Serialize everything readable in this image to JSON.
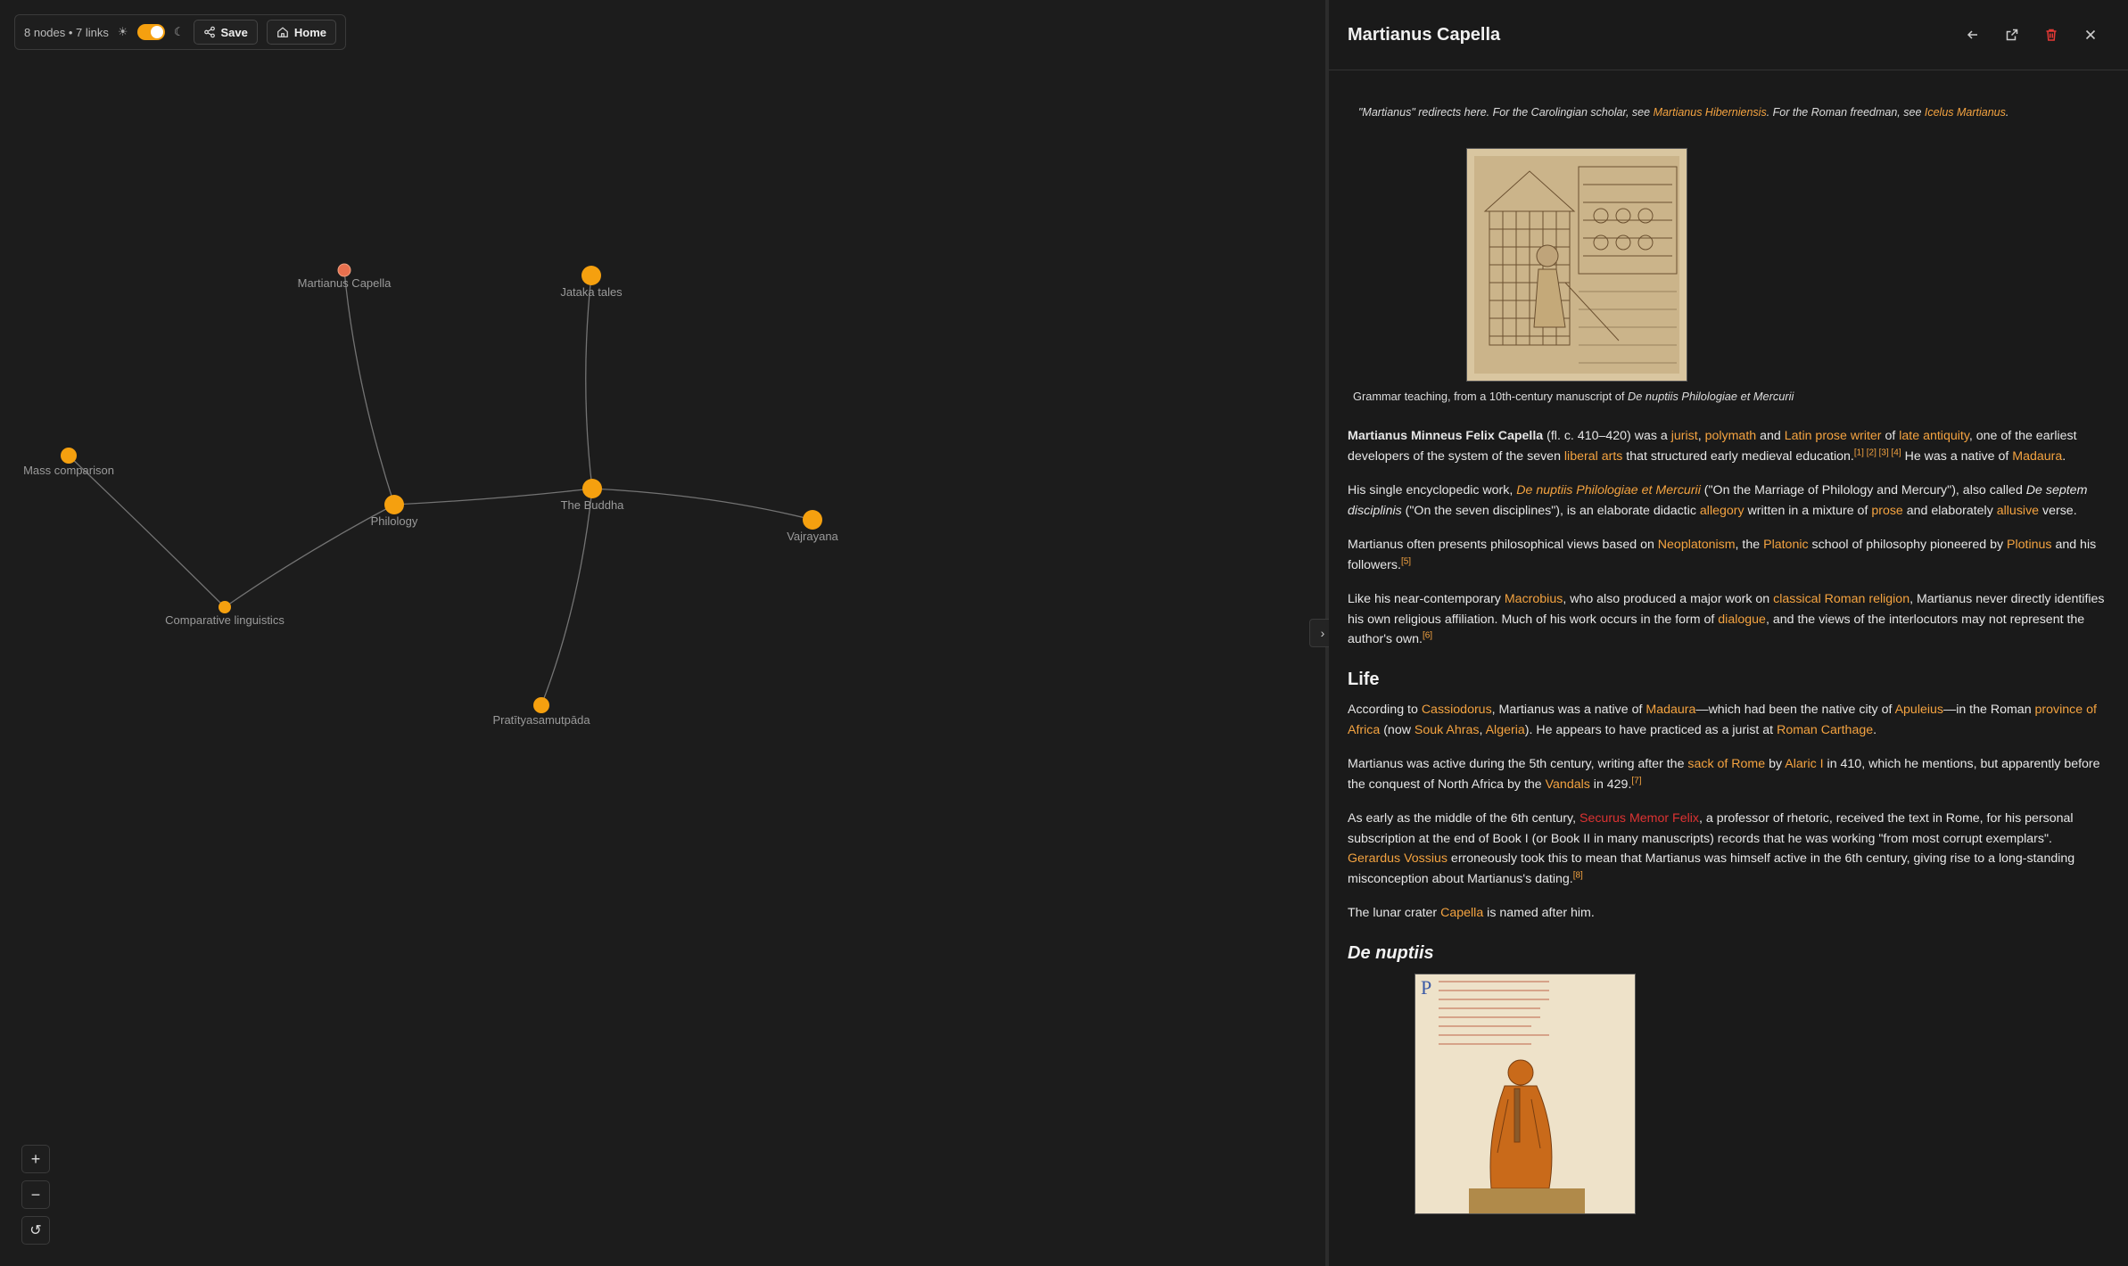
{
  "toolbar": {
    "stats": "8 nodes • 7 links",
    "save_label": "Save",
    "home_label": "Home",
    "theme_dark": true
  },
  "graph": {
    "nodes": [
      {
        "id": "martianus",
        "label": "Martianus Capella",
        "color": "#e8704e",
        "size": "small",
        "selected": true
      },
      {
        "id": "jataka",
        "label": "Jataka tales",
        "color": "#f5a00f",
        "size": "large"
      },
      {
        "id": "mass",
        "label": "Mass comparison",
        "color": "#f5a00f",
        "size": "medium"
      },
      {
        "id": "philology",
        "label": "Philology",
        "color": "#f5a00f",
        "size": "large"
      },
      {
        "id": "buddha",
        "label": "The Buddha",
        "color": "#f5a00f",
        "size": "large"
      },
      {
        "id": "vajrayana",
        "label": "Vajrayana",
        "color": "#f5a00f",
        "size": "large"
      },
      {
        "id": "complin",
        "label": "Comparative linguistics",
        "color": "#f5a00f",
        "size": "small"
      },
      {
        "id": "prat",
        "label": "Pratītyasamutpāda",
        "color": "#f5a00f",
        "size": "medium"
      }
    ],
    "links": [
      {
        "source": "martianus",
        "target": "philology"
      },
      {
        "source": "jataka",
        "target": "buddha"
      },
      {
        "source": "buddha",
        "target": "philology"
      },
      {
        "source": "buddha",
        "target": "vajrayana"
      },
      {
        "source": "buddha",
        "target": "prat"
      },
      {
        "source": "philology",
        "target": "complin"
      },
      {
        "source": "mass",
        "target": "complin"
      }
    ]
  },
  "zoom": {
    "in": "+",
    "out": "−",
    "reset": "↺"
  },
  "panel": {
    "title": "Martianus Capella",
    "hatnote": {
      "t1": "\"Martianus\" redirects here. For the Carolingian scholar, see ",
      "l1": "Martianus Hiberniensis",
      "t2": ". For the Roman freedman, see ",
      "l2": "Icelus Martianus",
      "t3": "."
    },
    "figure1_caption_pre": "Grammar teaching, from a 10th-century manuscript of ",
    "figure1_caption_it": "De nuptiis Philologiae et Mercurii",
    "p1": {
      "b": "Martianus Minneus Felix Capella",
      "t1": " (fl. c. 410–420) was a ",
      "l1": "jurist",
      "t2": ", ",
      "l2": "polymath",
      "t3": " and ",
      "l3": "Latin prose writer",
      "t4": " of ",
      "l4": "late antiquity",
      "t5": ", one of the earliest developers of the system of the seven ",
      "l5": "liberal arts",
      "t6": " that structured early medieval education.",
      "sup": "[1] [2] [3] [4]",
      "t7": " He was a native of ",
      "l6": "Madaura",
      "t8": "."
    },
    "p2": {
      "t1": "His single encyclopedic work, ",
      "l1": "De nuptiis Philologiae et Mercurii",
      "t2": " (\"On the Marriage of Philology and Mercury\"), also called ",
      "i1": "De septem disciplinis",
      "t3": " (\"On the seven disciplines\"), is an elaborate didactic ",
      "l2": "allegory",
      "t4": " written in a mixture of ",
      "l3": "prose",
      "t5": " and elaborately ",
      "l4": "allusive",
      "t6": " verse."
    },
    "p3": {
      "t1": "Martianus often presents philosophical views based on ",
      "l1": "Neoplatonism",
      "t2": ", the ",
      "l2": "Platonic",
      "t3": " school of philosophy pioneered by ",
      "l3": "Plotinus",
      "t4": " and his followers.",
      "sup": "[5]"
    },
    "p4": {
      "t1": "Like his near-contemporary ",
      "l1": "Macrobius",
      "t2": ", who also produced a major work on ",
      "l2": "classical Roman religion",
      "t3": ", Martianus never directly identifies his own religious affiliation. Much of his work occurs in the form of ",
      "l3": "dialogue",
      "t4": ", and the views of the interlocutors may not represent the author's own.",
      "sup": "[6]"
    },
    "h_life": "Life",
    "p5": {
      "t1": "According to ",
      "l1": "Cassiodorus",
      "t2": ", Martianus was a native of ",
      "l2": "Madaura",
      "t3": "—which had been the native city of ",
      "l3": "Apuleius",
      "t4": "—in the Roman ",
      "l4": "province of Africa",
      "t5": " (now ",
      "l5": "Souk Ahras",
      "t6": ", ",
      "l6": "Algeria",
      "t7": "). He appears to have practiced as a jurist at ",
      "l7": "Roman Carthage",
      "t8": "."
    },
    "p6": {
      "t1": "Martianus was active during the 5th century, writing after the ",
      "l1": "sack of Rome",
      "t2": " by ",
      "l2": "Alaric I",
      "t3": " in 410, which he mentions, but apparently before the conquest of North Africa by the ",
      "l3": "Vandals",
      "t4": " in 429.",
      "sup": "[7]"
    },
    "p7": {
      "t1": "As early as the middle of the 6th century, ",
      "l1": "Securus Memor Felix",
      "t2": ", a professor of rhetoric, received the text in Rome, for his personal subscription at the end of Book I (or Book II in many manuscripts) records that he was working \"from most corrupt exemplars\". ",
      "l2": "Gerardus Vossius",
      "t3": " erroneously took this to mean that Martianus was himself active in the 6th century, giving rise to a long-standing misconception about Martianus's dating.",
      "sup": "[8]"
    },
    "p8": {
      "t1": "The lunar crater ",
      "l1": "Capella",
      "t2": " is named after him."
    },
    "h_nuptiis": "De nuptiis"
  },
  "colors": {
    "accent": "#f5a00f",
    "link": "#f4a340",
    "redlink": "#dd3333",
    "selected": "#e8704e",
    "delete": "#e53935"
  },
  "icons": [
    "sun-icon",
    "moon-icon",
    "share-icon",
    "home-icon",
    "back-icon",
    "external-link-icon",
    "trash-icon",
    "close-icon",
    "chevron-right-icon",
    "plus-icon",
    "minus-icon",
    "reset-icon"
  ]
}
